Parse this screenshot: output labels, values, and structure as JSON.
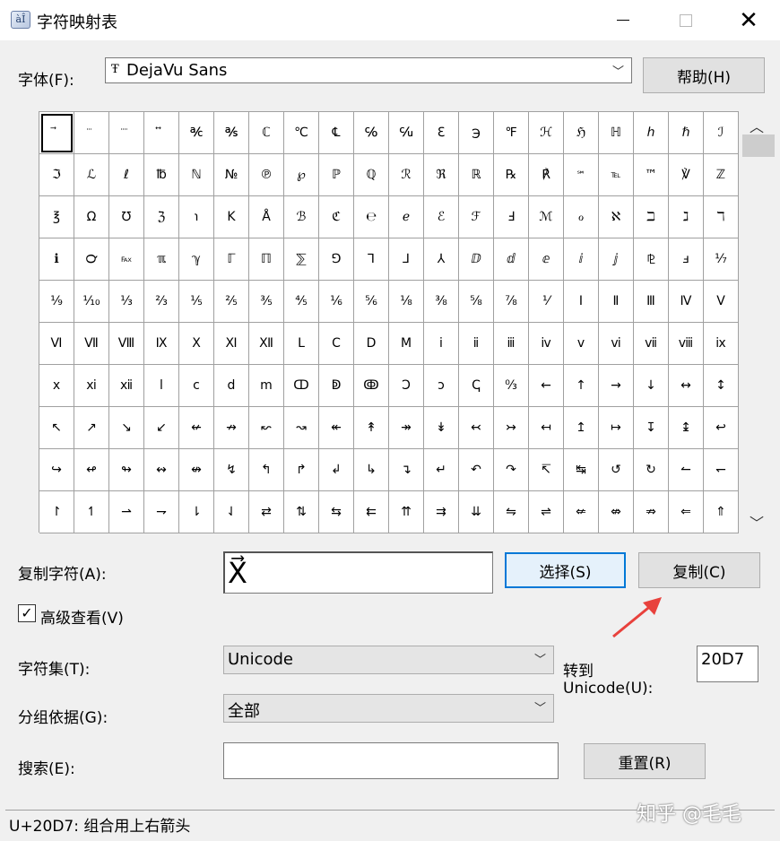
{
  "window": {
    "title": "字符映射表",
    "icon_name": "charmap-app-icon",
    "icon_glyph": "àÎ"
  },
  "font": {
    "label": "字体(F):",
    "selected": "DejaVu Sans",
    "type_badge": "Ŧ"
  },
  "buttons": {
    "help": "帮助(H)",
    "select": "选择(S)",
    "copy": "复制(C)",
    "reset": "重置(R)"
  },
  "copy_chars": {
    "label": "复制字符(A):",
    "value": "X⃗"
  },
  "advanced": {
    "label": "高级查看(V)",
    "checked": true
  },
  "charset": {
    "label": "字符集(T):",
    "value": "Unicode"
  },
  "group_by": {
    "label": "分组依据(G):",
    "value": "全部"
  },
  "goto": {
    "label_line1": "转到",
    "label_line2": "Unicode(U):",
    "value": "20D7"
  },
  "search": {
    "label": "搜索(E):",
    "value": ""
  },
  "status": "U+20D7: 组合用上右箭头",
  "watermark": "知乎 @毛毛",
  "colors": {
    "focus_border": "#0078d7",
    "arrow": "#e8413c"
  },
  "grid_chars": [
    [
      "⃗",
      "⃛",
      "⃜",
      "⃡",
      "℀",
      "℁",
      "ℂ",
      "℃",
      "℄",
      "℅",
      "℆",
      "ℇ",
      "℈",
      "℉",
      "ℋ",
      "ℌ",
      "ℍ",
      "ℎ",
      "ℏ",
      "ℐ"
    ],
    [
      "ℑ",
      "ℒ",
      "ℓ",
      "℔",
      "ℕ",
      "№",
      "℗",
      "℘",
      "ℙ",
      "ℚ",
      "ℛ",
      "ℜ",
      "ℝ",
      "℞",
      "℟",
      "℠",
      "℡",
      "™",
      "℣",
      "ℤ"
    ],
    [
      "℥",
      "Ω",
      "℧",
      "ℨ",
      "℩",
      "K",
      "Å",
      "ℬ",
      "ℭ",
      "℮",
      "ℯ",
      "ℰ",
      "ℱ",
      "Ⅎ",
      "ℳ",
      "ℴ",
      "ℵ",
      "ℶ",
      "ℷ",
      "ℸ"
    ],
    [
      "ℹ",
      "℺",
      "℻",
      "ℼ",
      "ℽ",
      "ℾ",
      "ℿ",
      "⅀",
      "⅁",
      "⅂",
      "⅃",
      "⅄",
      "ⅅ",
      "ⅆ",
      "ⅇ",
      "ⅈ",
      "ⅉ",
      "⅊",
      "ⅎ",
      "⅐"
    ],
    [
      "⅑",
      "⅒",
      "⅓",
      "⅔",
      "⅕",
      "⅖",
      "⅗",
      "⅘",
      "⅙",
      "⅚",
      "⅛",
      "⅜",
      "⅝",
      "⅞",
      "⅟",
      "Ⅰ",
      "Ⅱ",
      "Ⅲ",
      "Ⅳ",
      "Ⅴ"
    ],
    [
      "Ⅵ",
      "Ⅶ",
      "Ⅷ",
      "Ⅸ",
      "Ⅹ",
      "Ⅺ",
      "Ⅻ",
      "Ⅼ",
      "Ⅽ",
      "Ⅾ",
      "Ⅿ",
      "ⅰ",
      "ⅱ",
      "ⅲ",
      "ⅳ",
      "ⅴ",
      "ⅵ",
      "ⅶ",
      "ⅷ",
      "ⅸ"
    ],
    [
      "ⅹ",
      "ⅺ",
      "ⅻ",
      "ⅼ",
      "ⅽ",
      "ⅾ",
      "ⅿ",
      "ↀ",
      "ↁ",
      "ↂ",
      "Ↄ",
      "ↄ",
      "ↅ",
      "↉",
      "←",
      "↑",
      "→",
      "↓",
      "↔",
      "↕"
    ],
    [
      "↖",
      "↗",
      "↘",
      "↙",
      "↚",
      "↛",
      "↜",
      "↝",
      "↞",
      "↟",
      "↠",
      "↡",
      "↢",
      "↣",
      "↤",
      "↥",
      "↦",
      "↧",
      "↨",
      "↩"
    ],
    [
      "↪",
      "↫",
      "↬",
      "↭",
      "↮",
      "↯",
      "↰",
      "↱",
      "↲",
      "↳",
      "↴",
      "↵",
      "↶",
      "↷",
      "↸",
      "↹",
      "↺",
      "↻",
      "↼",
      "↽"
    ],
    [
      "↾",
      "↿",
      "⇀",
      "⇁",
      "⇂",
      "⇃",
      "⇄",
      "⇅",
      "⇆",
      "⇇",
      "⇈",
      "⇉",
      "⇊",
      "⇋",
      "⇌",
      "⇍",
      "⇎",
      "⇏",
      "⇐",
      "⇑"
    ]
  ]
}
